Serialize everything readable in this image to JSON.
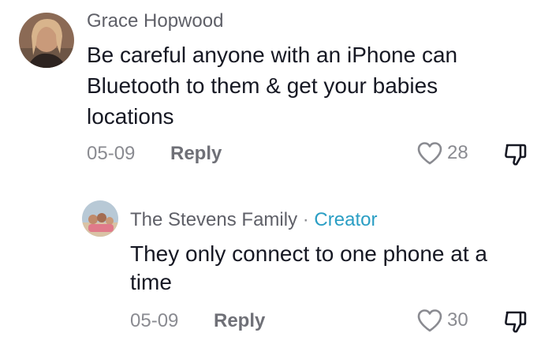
{
  "comments": [
    {
      "author": "Grace Hopwood",
      "text_lines": [
        "Be careful anyone with an iPhone can",
        "Bluetooth to them & get your babies",
        "locations"
      ],
      "date": "05-09",
      "reply_label": "Reply",
      "likes": "28",
      "avatar_icon": "profile-photo"
    }
  ],
  "reply": {
    "author": "The Stevens Family",
    "separator": "·",
    "badge": "Creator",
    "text_lines": [
      "They only connect to one phone at a",
      "time"
    ],
    "date": "05-09",
    "reply_label": "Reply",
    "likes": "30",
    "avatar_icon": "profile-photo"
  },
  "colors": {
    "creator_badge": "#2a9ec4",
    "text": "#161823",
    "secondary": "#8a8b91"
  }
}
